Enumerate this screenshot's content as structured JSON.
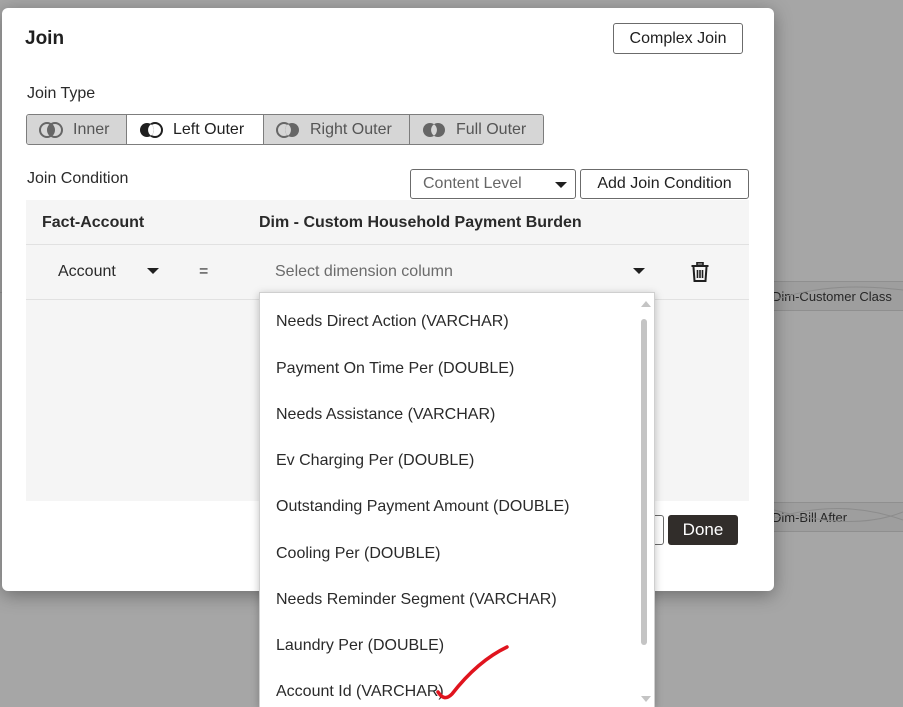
{
  "canvas": {
    "node_customer_class": "Dim-Customer Class",
    "node_bill_after": "Dim-Bill After"
  },
  "dialog": {
    "title": "Join",
    "complex_join_label": "Complex Join",
    "join_type_label": "Join Type",
    "join_types": [
      {
        "label": "Inner",
        "selected": false
      },
      {
        "label": "Left Outer",
        "selected": true
      },
      {
        "label": "Right Outer",
        "selected": false
      },
      {
        "label": "Full Outer",
        "selected": false
      }
    ],
    "join_condition_label": "Join Condition",
    "content_level": "Content Level",
    "add_join_condition_label": "Add Join Condition",
    "table": {
      "left_header": "Fact-Account",
      "right_header": "Dim - Custom Household Payment Burden",
      "row": {
        "left_value": "Account",
        "operator": "=",
        "right_placeholder": "Select dimension column"
      }
    },
    "done_label": "Done"
  },
  "dropdown": {
    "options": [
      "Needs Direct Action (VARCHAR)",
      "Payment On Time Per (DOUBLE)",
      "Needs Assistance (VARCHAR)",
      "Ev Charging Per (DOUBLE)",
      "Outstanding Payment Amount (DOUBLE)",
      "Cooling Per (DOUBLE)",
      "Needs Reminder Segment (VARCHAR)",
      "Laundry Per (DOUBLE)",
      "Account Id (VARCHAR)"
    ]
  },
  "colors": {
    "overlay": "#a6a6a6",
    "done_button": "#312d2a",
    "annotation_mark": "#e0141e"
  },
  "icons": {
    "join_icon": "venn-diagram-icon",
    "dropdown_icon": "caret-down-icon",
    "delete_icon": "trash-icon",
    "annotation": "checkmark-icon"
  }
}
